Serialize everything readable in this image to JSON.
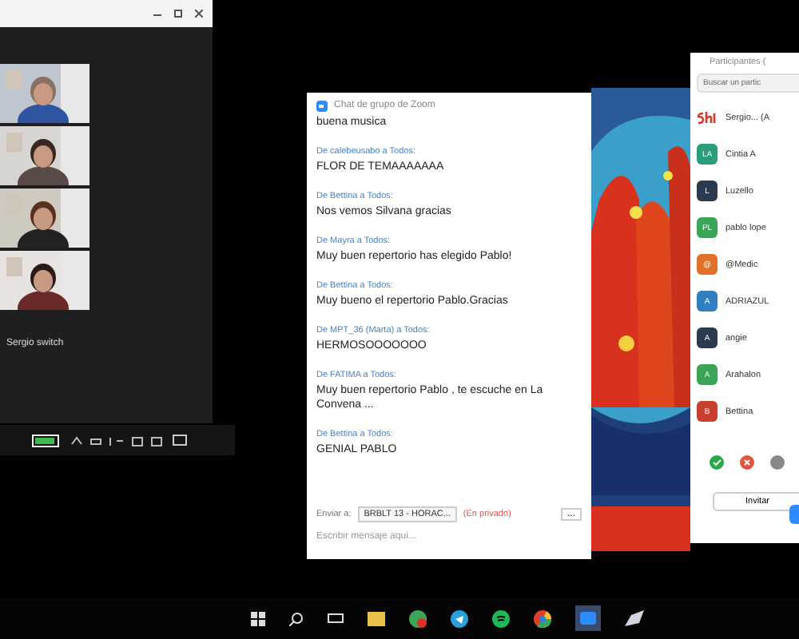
{
  "video_window": {
    "speaker_name": "Sergio switch"
  },
  "chat": {
    "title": "Chat de grupo de Zoom",
    "first_text": "buena musica",
    "messages": [
      {
        "from": "De calebeusabo a Todos:",
        "text": "FLOR DE TEMAAAAAAA"
      },
      {
        "from": "De Bettina a Todos:",
        "text": "Nos vemos Silvana gracias"
      },
      {
        "from": "De Mayra a Todos:",
        "text": "Muy buen repertorio has elegido Pablo!"
      },
      {
        "from": "De Bettina a Todos:",
        "text": "Muy bueno el repertorio Pablo.Gracias"
      },
      {
        "from": "De MPT_36 (Marta) a Todos:",
        "text": "HERMOSOOOOOOO"
      },
      {
        "from": "De FATIMA a Todos:",
        "text": "Muy buen repertorio Pablo , te escuche en La Convena ..."
      },
      {
        "from": "De Bettina a Todos:",
        "text": "GENIAL PABLO"
      }
    ],
    "send_to_label": "Enviar a:",
    "recipient": "BRBLT 13 - HORAC...",
    "privacy": "(En privado)",
    "more": "...",
    "placeholder": "Escribir mensaje aquí..."
  },
  "participants": {
    "title": "Participantes (",
    "search_placeholder": "Buscar un partic",
    "items": [
      {
        "kind": "logo",
        "name": "Sergio... (A",
        "color": "#d83b2b"
      },
      {
        "kind": "initials",
        "initials": "LA",
        "name": "Cintia A",
        "color": "#2a9d7c"
      },
      {
        "kind": "initials",
        "initials": "L",
        "name": "Luzello",
        "color": "#2b3a4f"
      },
      {
        "kind": "initials",
        "initials": "PL",
        "name": "pablo lope",
        "color": "#3aa556"
      },
      {
        "kind": "initials",
        "initials": "@",
        "name": "@Medic",
        "color": "#e0702a"
      },
      {
        "kind": "initials",
        "initials": "A",
        "name": "ADRIAZUL",
        "color": "#2f7fc1"
      },
      {
        "kind": "initials",
        "initials": "A",
        "name": "angie",
        "color": "#2b3a4f"
      },
      {
        "kind": "initials",
        "initials": "A",
        "name": "Arahalon",
        "color": "#3aa556"
      },
      {
        "kind": "initials",
        "initials": "B",
        "name": "Bettina",
        "color": "#c8402e"
      }
    ],
    "invite_button": "Invitar"
  }
}
